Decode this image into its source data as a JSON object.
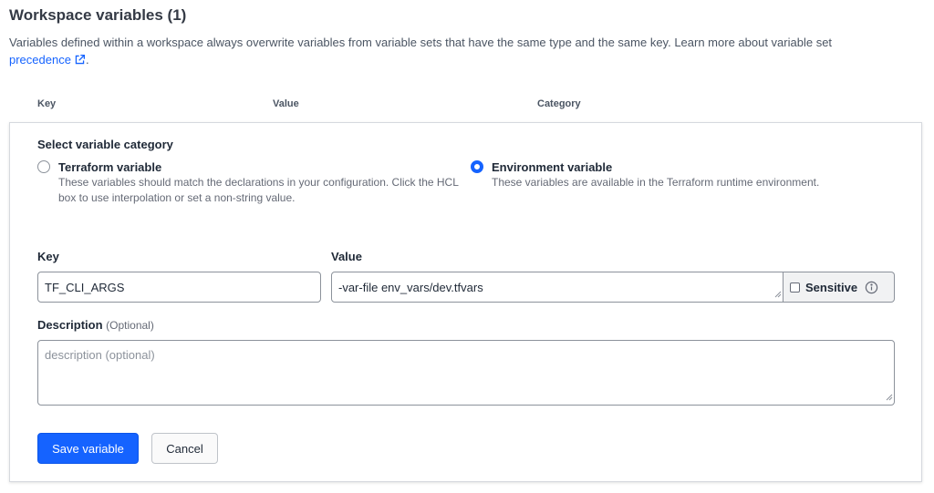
{
  "header": {
    "title": "Workspace variables (1)",
    "description": "Variables defined within a workspace always overwrite variables from variable sets that have the same type and the same key. Learn more about variable set",
    "link_text": "precedence",
    "link_suffix": "."
  },
  "columns": [
    "Key",
    "Value",
    "Category"
  ],
  "form": {
    "category_heading": "Select variable category",
    "options": [
      {
        "label": "Terraform variable",
        "help": "These variables should match the declarations in your configuration. Click the HCL box to use interpolation or set a non-string value.",
        "selected": false
      },
      {
        "label": "Environment variable",
        "help": "These variables are available in the Terraform runtime environment.",
        "selected": true
      }
    ],
    "key_label": "Key",
    "key_value": "TF_CLI_ARGS",
    "value_label": "Value",
    "value_value": "-var-file env_vars/dev.tfvars",
    "sensitive_label": "Sensitive",
    "sensitive_checked": false,
    "description_label": "Description",
    "description_optional": "(Optional)",
    "description_placeholder": "description (optional)",
    "save_label": "Save variable",
    "cancel_label": "Cancel"
  },
  "icons": {
    "external_link": "external-link-icon",
    "info": "info-icon",
    "resize": "resize-handle-icon"
  },
  "colors": {
    "accent": "#1563ff",
    "border": "#8c929b",
    "muted_text": "#656a76"
  }
}
